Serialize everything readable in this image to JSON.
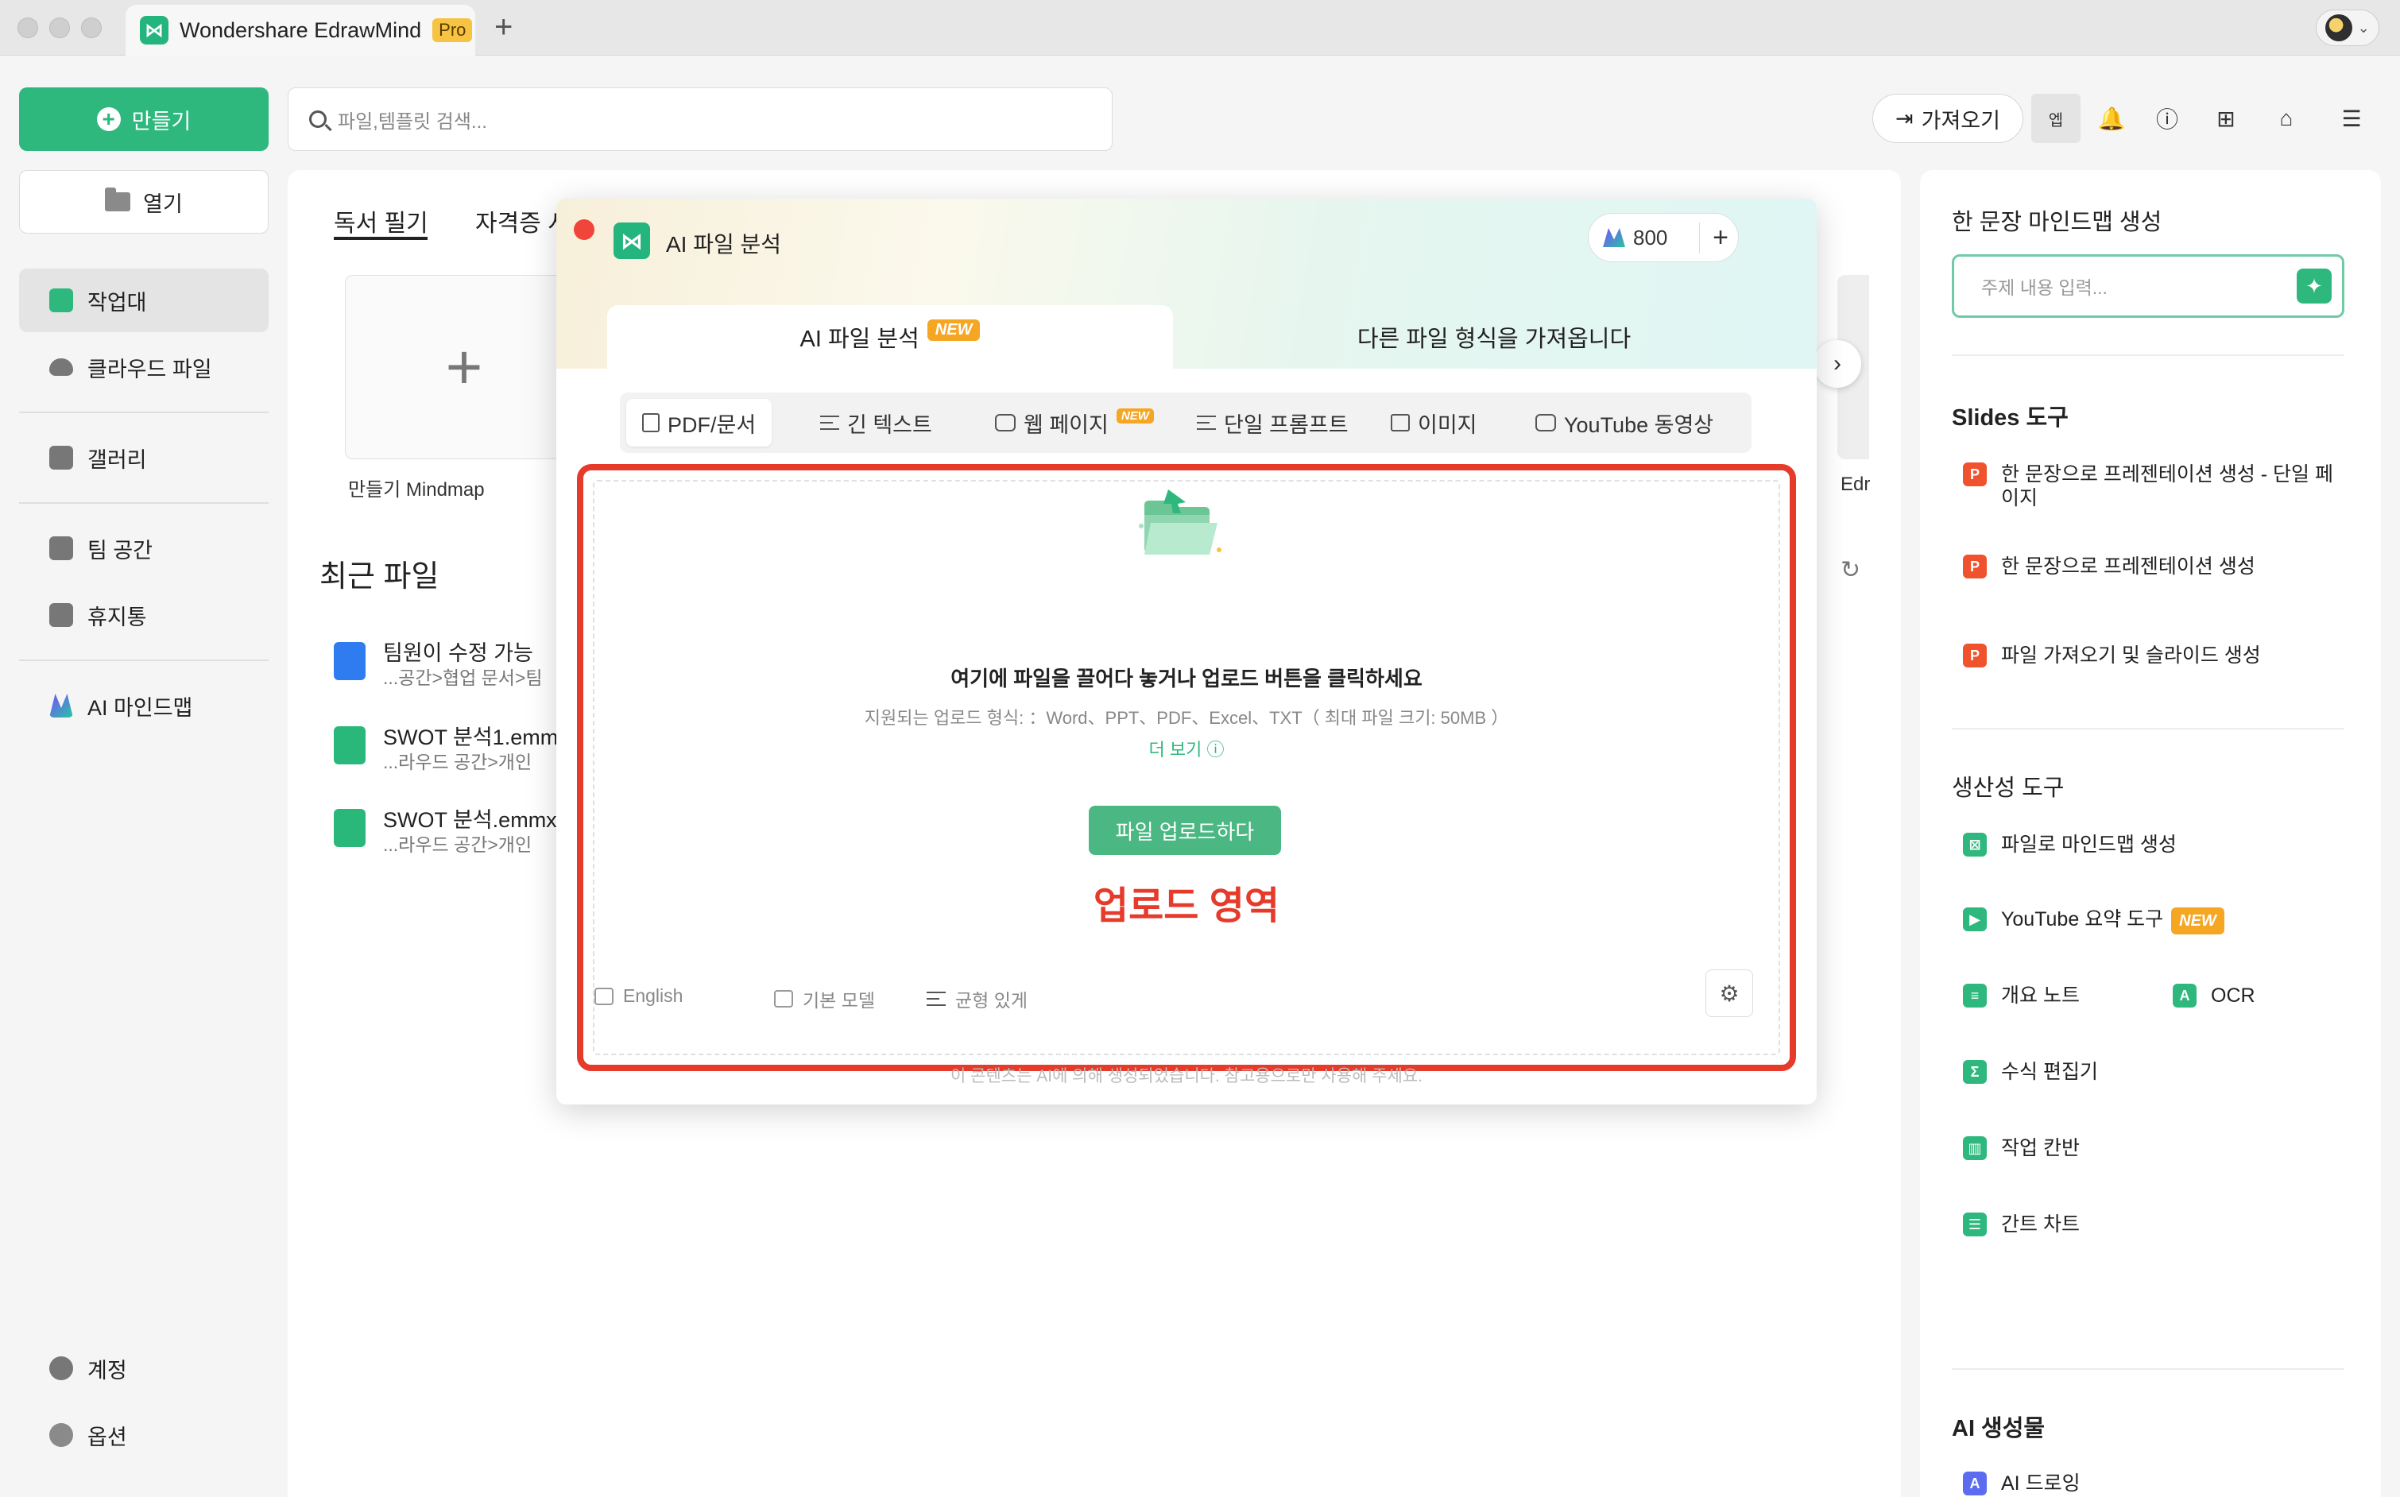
{
  "window": {
    "app_title": "Wondershare EdrawMind",
    "pro_badge": "Pro",
    "new_tab": "+"
  },
  "sidebar": {
    "create_label": "만들기",
    "open_label": "열기",
    "items": [
      {
        "label": "작업대",
        "icon": "workbench-icon",
        "active": true
      },
      {
        "label": "클라우드 파일",
        "icon": "cloud-icon"
      },
      {
        "label": "갤러리",
        "icon": "gallery-icon"
      },
      {
        "label": "팀 공간",
        "icon": "team-space-icon"
      },
      {
        "label": "휴지통",
        "icon": "trash-icon"
      },
      {
        "label": "AI 마인드맵",
        "icon": "ai-mindmap-icon"
      }
    ],
    "bottom": [
      {
        "label": "계정",
        "icon": "account-icon"
      },
      {
        "label": "옵션",
        "icon": "gear-icon"
      }
    ]
  },
  "search": {
    "placeholder": "파일,템플릿 검색..."
  },
  "toolbar": {
    "import_label": "가져오기",
    "shade_label": "엡"
  },
  "main": {
    "tabs": [
      "독서 필기",
      "자격증 시"
    ],
    "template_caption": "만들기 Mindmap",
    "right_card_caption": "Edr",
    "recent_title": "최근 파일",
    "recent_files": [
      {
        "name": "팀원이 수정 가능",
        "path": "...공간>협업 문서>팀"
      },
      {
        "name": "SWOT 분석1.emm",
        "path": "...라우드 공간>개인"
      },
      {
        "name": "SWOT 분석.emmx",
        "path": "...라우드 공간>개인"
      }
    ]
  },
  "right_panel": {
    "one_sentence_title": "한 문장 마인드맵 생성",
    "topic_placeholder": "주제 내용 입력...",
    "slides_title": "Slides 도구",
    "slides_items": [
      "한 문장으로 프레젠테이션 생성 - 단일 페이지",
      "한 문장으로 프레젠테이션 생성",
      "파일 가져오기 및 슬라이드 생성"
    ],
    "productivity_title": "생산성 도구",
    "productivity_items": [
      "파일로 마인드맵 생성",
      "YouTube 요약 도구",
      "개요 노트",
      "OCR",
      "수식 편집기",
      "작업 칸반",
      "간트 차트"
    ],
    "new_tag": "NEW",
    "ai_output_title": "AI 생성물",
    "ai_output_items": [
      "AI 드로잉"
    ]
  },
  "modal": {
    "title": "AI 파일 분석",
    "credits": "800",
    "tabs": [
      "AI 파일 분석",
      "다른 파일 형식을 가져옵니다"
    ],
    "new_tag": "NEW",
    "subtabs": [
      "PDF/문서",
      "긴 텍스트",
      "웹 페이지",
      "단일 프롬프트",
      "이미지",
      "YouTube 동영상"
    ],
    "upload": {
      "title": "여기에 파일을 끌어다 놓거나 업로드 버튼을 클릭하세요",
      "formats": "지원되는 업로드 형식: ：Word、PPT、PDF、Excel、TXT（ 최대 파일 크기: 50MB ）",
      "more": "더 보기",
      "button": "파일 업로드하다",
      "area_label": "업로드 영역"
    },
    "options": [
      "English",
      "기본 모델",
      "균형 있게"
    ],
    "disclaimer": "이 콘텐츠는 AI에 의해 생성되었습니다. 참고용으로만 사용해 주세요."
  },
  "colors": {
    "brand_green": "#2eb87e",
    "highlight_red": "#e63a2b",
    "new_orange": "#f5a623"
  }
}
